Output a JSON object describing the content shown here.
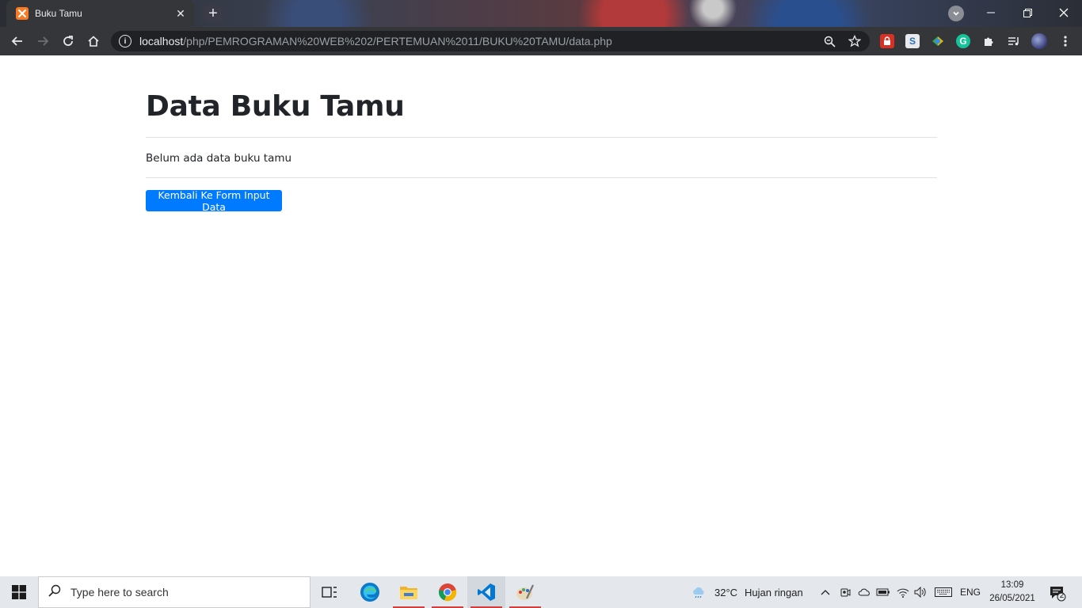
{
  "browser": {
    "tab_title": "Buku Tamu",
    "tab_close": "✕",
    "new_tab": "+",
    "url_host": "localhost",
    "url_path": "/php/PEMROGRAMAN%20WEB%202/PERTEMUAN%2011/BUKU%20TAMU/data.php",
    "icons": [
      "back-icon",
      "forward-icon",
      "reload-icon",
      "home-icon",
      "site-info-icon",
      "zoom-icon",
      "bookmark-star-icon",
      "extension-icon",
      "media-icon",
      "profile-icon",
      "menu-icon"
    ]
  },
  "page": {
    "title": "Data Buku Tamu",
    "empty_message": "Belum ada data buku tamu",
    "back_button": "Kembali Ke Form Input Data",
    "button_color": "#007bff"
  },
  "taskbar": {
    "search_placeholder": "Type here to search",
    "weather_temp": "32°C",
    "weather_desc": "Hujan ringan",
    "language": "ENG",
    "time": "13:09",
    "date": "26/05/2021",
    "notification_count": "2",
    "apps": [
      "task-view",
      "edge",
      "file-explorer",
      "chrome",
      "vscode",
      "paint"
    ]
  }
}
